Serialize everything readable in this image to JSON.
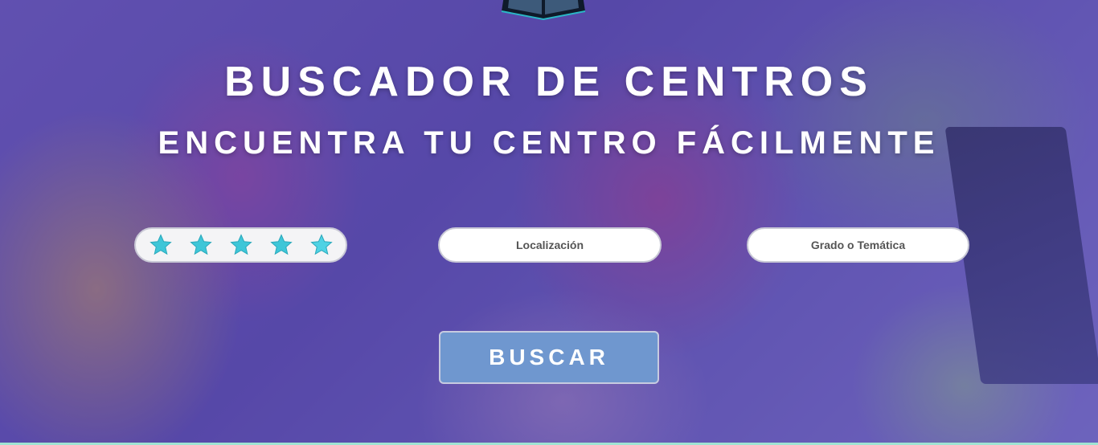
{
  "hero": {
    "title": "BUSCADOR DE CENTROS",
    "subtitle": "ENCUENTRA TU CENTRO FÁCILMENTE"
  },
  "filters": {
    "rating": {
      "stars": 5,
      "max": 5,
      "color": "#3ec6d8"
    },
    "location_label": "Localización",
    "grado_label": "Grado o Temática"
  },
  "search_button": {
    "label": "BUSCAR",
    "color": "#6f97cf"
  },
  "logo": {
    "icon": "open-book-icon"
  },
  "colors": {
    "overlay": "#5a4aa8",
    "accent_line": "#9fe3d3"
  }
}
